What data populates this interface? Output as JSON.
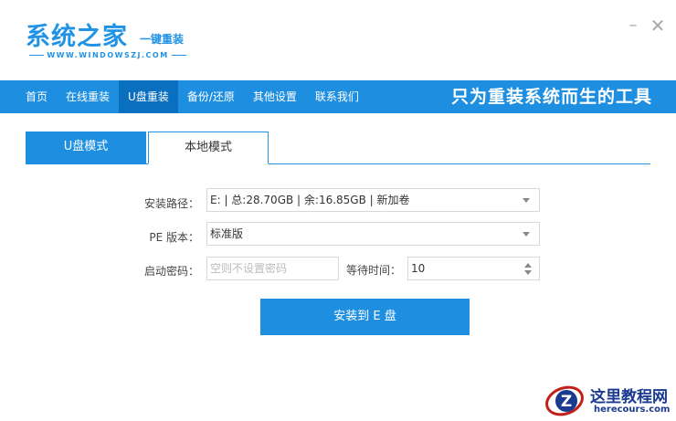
{
  "app": {
    "title": "系统之家",
    "subtitle": "一键重装",
    "url": "WWW.WINDOWSZJ.COM"
  },
  "window": {
    "minimize": "–",
    "close": "✕"
  },
  "nav": {
    "items": [
      {
        "label": "首页"
      },
      {
        "label": "在线重装"
      },
      {
        "label": "U盘重装"
      },
      {
        "label": "备份/还原"
      },
      {
        "label": "其他设置"
      },
      {
        "label": "联系我们"
      }
    ],
    "active_index": 2,
    "slogan": "只为重装系统而生的工具"
  },
  "tabs": {
    "u_mode": "U盘模式",
    "local_mode": "本地模式",
    "active": "本地模式"
  },
  "form": {
    "install_path_label": "安装路径：",
    "install_path_value": "E: | 总:28.70GB | 余:16.85GB | 新加卷",
    "pe_version_label": "PE 版本：",
    "pe_version_value": "标准版",
    "boot_password_label": "启动密码：",
    "boot_password_placeholder": "空则不设置密码",
    "wait_time_label": "等待时间：",
    "wait_time_value": "10"
  },
  "install_button": "安装到 E 盘",
  "watermark": {
    "name": "这里教程网",
    "url": "herecours.com"
  },
  "colors": {
    "brand_blue": "#1e8fe0",
    "nav_active": "#0b6fbf"
  }
}
